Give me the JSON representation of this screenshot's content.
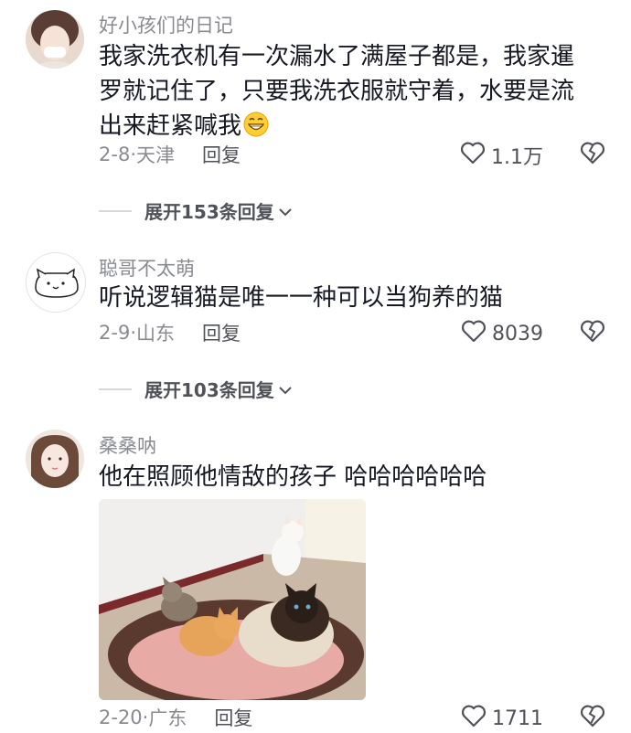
{
  "comments": [
    {
      "username": "好小孩们的日记",
      "text": "我家洗衣机有一次漏水了满屋子都是，我家暹罗就记住了，只要我洗衣服就守着，水要是流出来赶紧喊我",
      "emoji": "grinning-face-emoji",
      "date": "2-8",
      "location": "天津",
      "reply_label": "回复",
      "likes": "1.1万",
      "expand_label": "展开153条回复"
    },
    {
      "username": "聪哥不太萌",
      "text": "听说逻辑猫是唯一一种可以当狗养的猫",
      "date": "2-9",
      "location": "山东",
      "reply_label": "回复",
      "likes": "8039",
      "expand_label": "展开103条回复"
    },
    {
      "username": "桑桑呐",
      "text": "他在照顾他情敌的孩子 哈哈哈哈哈哈",
      "image": "cats-on-pet-bed-photo",
      "date": "2-20",
      "location": "广东",
      "reply_label": "回复",
      "likes": "1711"
    }
  ],
  "colors": {
    "primary_text": "#161823",
    "secondary_text": "#8a8b91",
    "reply_text": "#505258"
  }
}
